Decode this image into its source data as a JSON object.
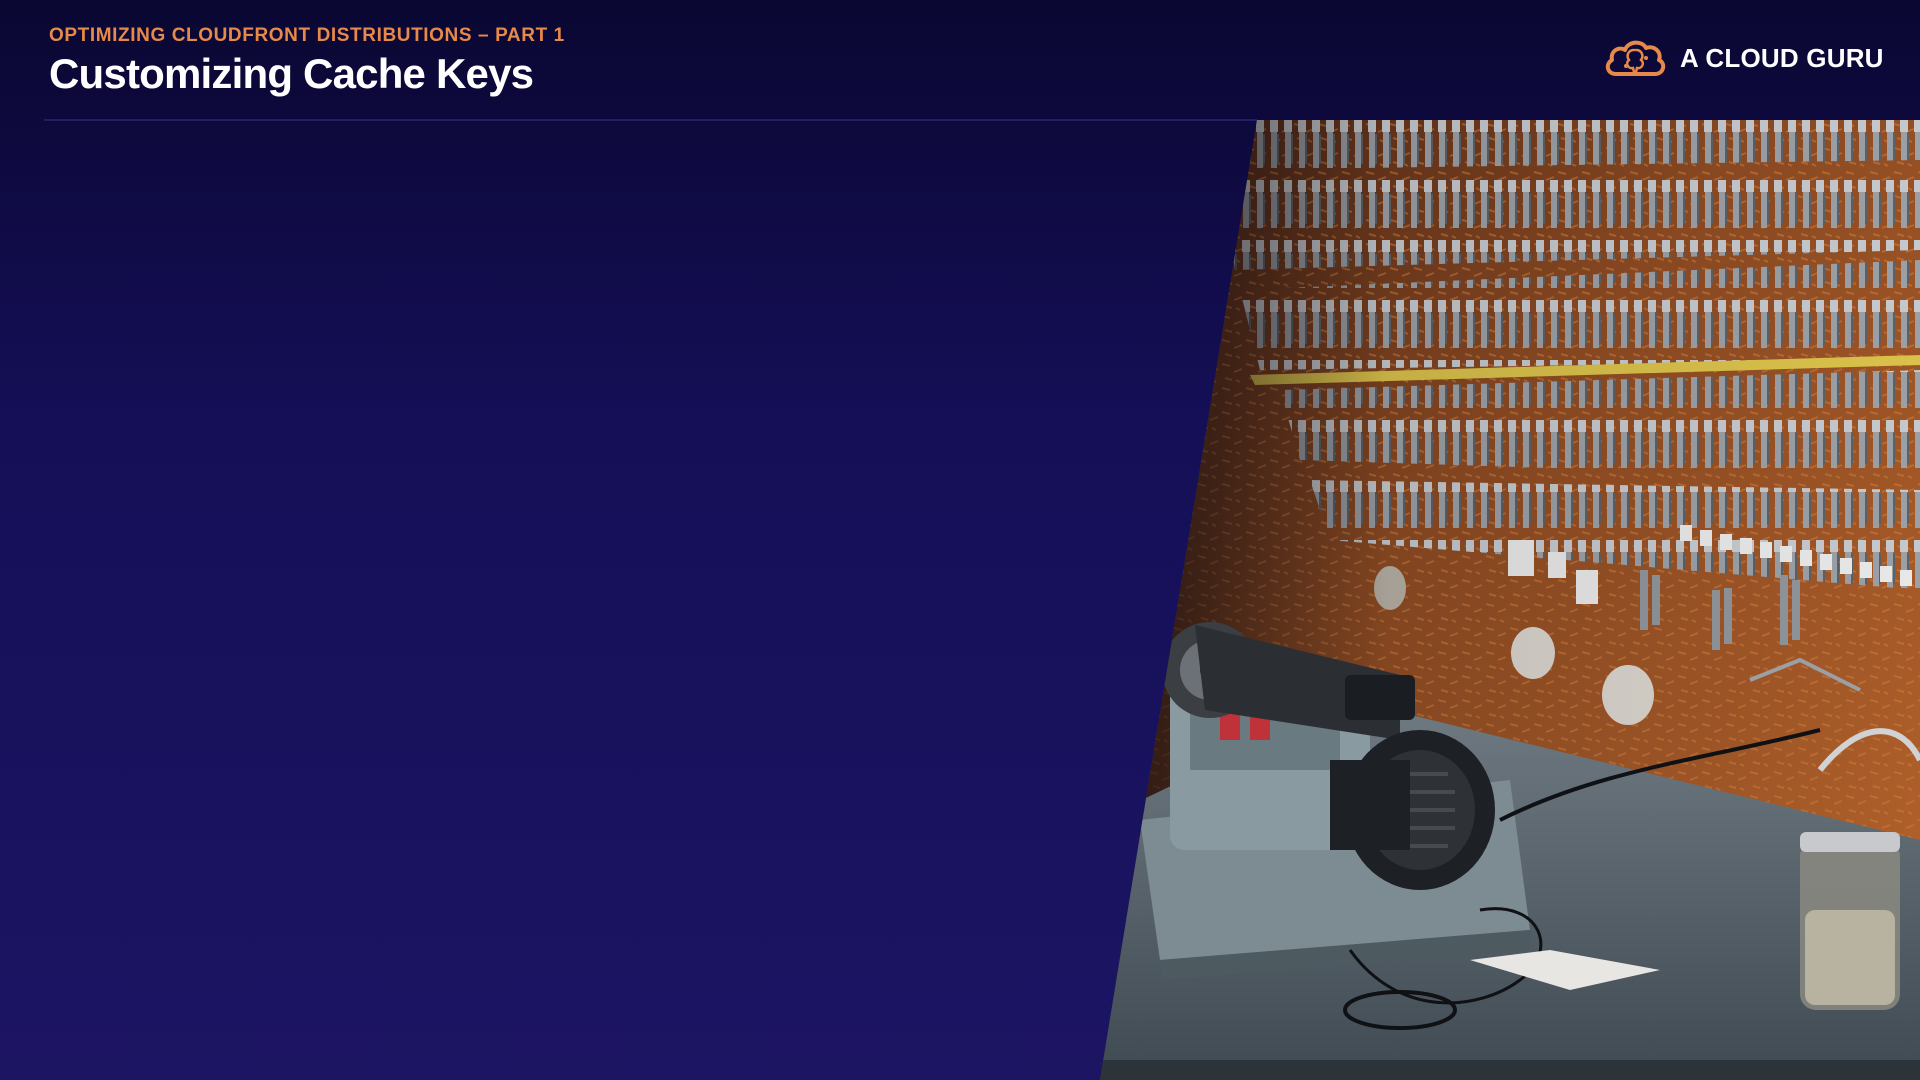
{
  "slide": {
    "subtitle": "OPTIMIZING CLOUDFRONT DISTRIBUTIONS – PART 1",
    "title": "Customizing Cache Keys"
  },
  "logo": {
    "text": "A CLOUD GURU",
    "icon": "cloud-brain-icon"
  },
  "photo": {
    "subject": "key-cutting-workshop-photo"
  },
  "colors": {
    "background_top": "#0a0732",
    "background_bottom": "#1c1563",
    "accent_orange": "#e7894a",
    "title_white": "#ffffff"
  }
}
